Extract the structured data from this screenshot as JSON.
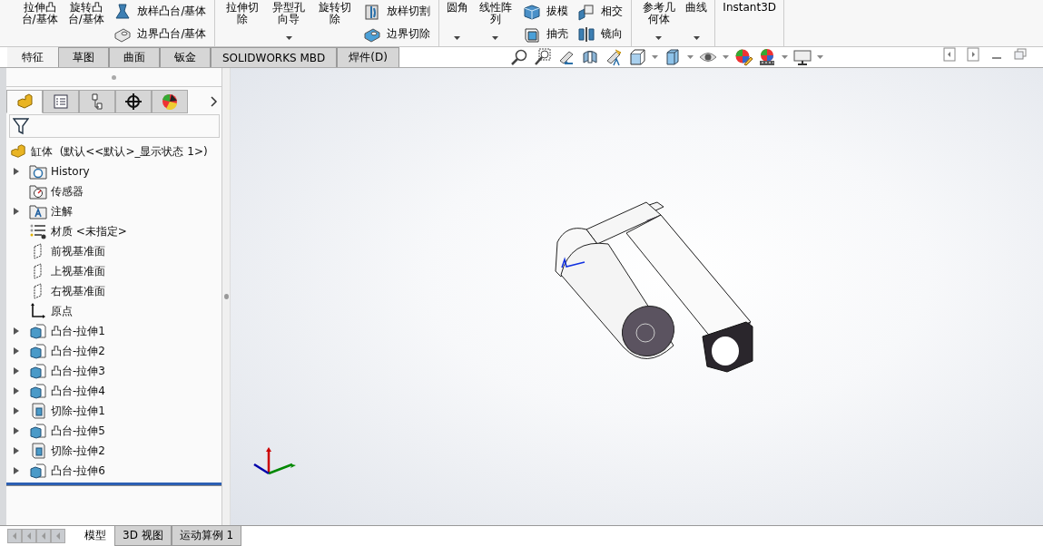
{
  "ribbon": {
    "groups": [
      {
        "buttons": [
          {
            "kind": "large",
            "label": "拉伸凸台/基体",
            "dropdown": false
          },
          {
            "kind": "large",
            "label": "旋转凸台/基体",
            "dropdown": false
          },
          {
            "kind": "stack",
            "items": [
              {
                "kind": "loft",
                "label": "放样凸台/基体"
              },
              {
                "kind": "boundary",
                "label": "边界凸台/基体"
              }
            ]
          }
        ]
      },
      {
        "buttons": [
          {
            "kind": "large",
            "label": "拉伸切除",
            "dropdown": false
          },
          {
            "kind": "large",
            "label": "异型孔向导",
            "dropdown": true
          },
          {
            "kind": "large",
            "label": "旋转切除",
            "dropdown": false
          },
          {
            "kind": "stack",
            "items": [
              {
                "kind": "loft-cut",
                "label": "放样切割"
              },
              {
                "kind": "boundary-cut",
                "label": "边界切除"
              }
            ]
          }
        ]
      },
      {
        "buttons": [
          {
            "kind": "large",
            "label": "圆角",
            "dropdown": true
          },
          {
            "kind": "large",
            "label": "线性阵列",
            "dropdown": true
          },
          {
            "kind": "stack",
            "items": [
              {
                "kind": "draft",
                "label": "拔模"
              },
              {
                "kind": "shell",
                "label": "抽壳"
              }
            ]
          },
          {
            "kind": "stack",
            "items": [
              {
                "kind": "intersect",
                "label": "相交"
              },
              {
                "kind": "mirror",
                "label": "镜向"
              }
            ]
          }
        ]
      },
      {
        "buttons": [
          {
            "kind": "large",
            "label": "参考几何体",
            "dropdown": true
          },
          {
            "kind": "large",
            "label": "曲线",
            "dropdown": true
          }
        ]
      },
      {
        "buttons": [
          {
            "kind": "large",
            "label": "Instant3D",
            "dropdown": false
          }
        ]
      }
    ]
  },
  "tabs": [
    {
      "label": "特征",
      "selected": true
    },
    {
      "label": "草图",
      "selected": false
    },
    {
      "label": "曲面",
      "selected": false
    },
    {
      "label": "钣金",
      "selected": false
    },
    {
      "label": "SOLIDWORKS MBD",
      "selected": false
    },
    {
      "label": "焊件(D)",
      "selected": false
    }
  ],
  "panel_tabs": [
    {
      "kind": "feature-tree",
      "selected": true
    },
    {
      "kind": "property",
      "selected": false
    },
    {
      "kind": "config",
      "selected": false
    },
    {
      "kind": "dimxpert",
      "selected": false
    },
    {
      "kind": "display",
      "selected": false
    }
  ],
  "tree": {
    "root": "缸体  (默认<<默认>_显示状态 1>)",
    "items": [
      {
        "kind": "history",
        "label": "History",
        "expandable": true
      },
      {
        "kind": "sensor",
        "label": "传感器",
        "expandable": false
      },
      {
        "kind": "annotation",
        "label": "注解",
        "expandable": true
      },
      {
        "kind": "material",
        "label": "材质 <未指定>",
        "expandable": false
      },
      {
        "kind": "plane",
        "label": "前视基准面",
        "expandable": false
      },
      {
        "kind": "plane",
        "label": "上视基准面",
        "expandable": false
      },
      {
        "kind": "plane",
        "label": "右视基准面",
        "expandable": false
      },
      {
        "kind": "origin",
        "label": "原点",
        "expandable": false
      },
      {
        "kind": "boss",
        "label": "凸台-拉伸1",
        "expandable": true
      },
      {
        "kind": "boss",
        "label": "凸台-拉伸2",
        "expandable": true
      },
      {
        "kind": "boss",
        "label": "凸台-拉伸3",
        "expandable": true
      },
      {
        "kind": "boss",
        "label": "凸台-拉伸4",
        "expandable": true
      },
      {
        "kind": "cut",
        "label": "切除-拉伸1",
        "expandable": true
      },
      {
        "kind": "boss",
        "label": "凸台-拉伸5",
        "expandable": true
      },
      {
        "kind": "cut",
        "label": "切除-拉伸2",
        "expandable": true
      },
      {
        "kind": "boss",
        "label": "凸台-拉伸6",
        "expandable": true
      }
    ]
  },
  "bottom_tabs": [
    {
      "label": "模型",
      "selected": true
    },
    {
      "label": "3D 视图",
      "selected": false
    },
    {
      "label": "运动算例 1",
      "selected": false
    }
  ]
}
